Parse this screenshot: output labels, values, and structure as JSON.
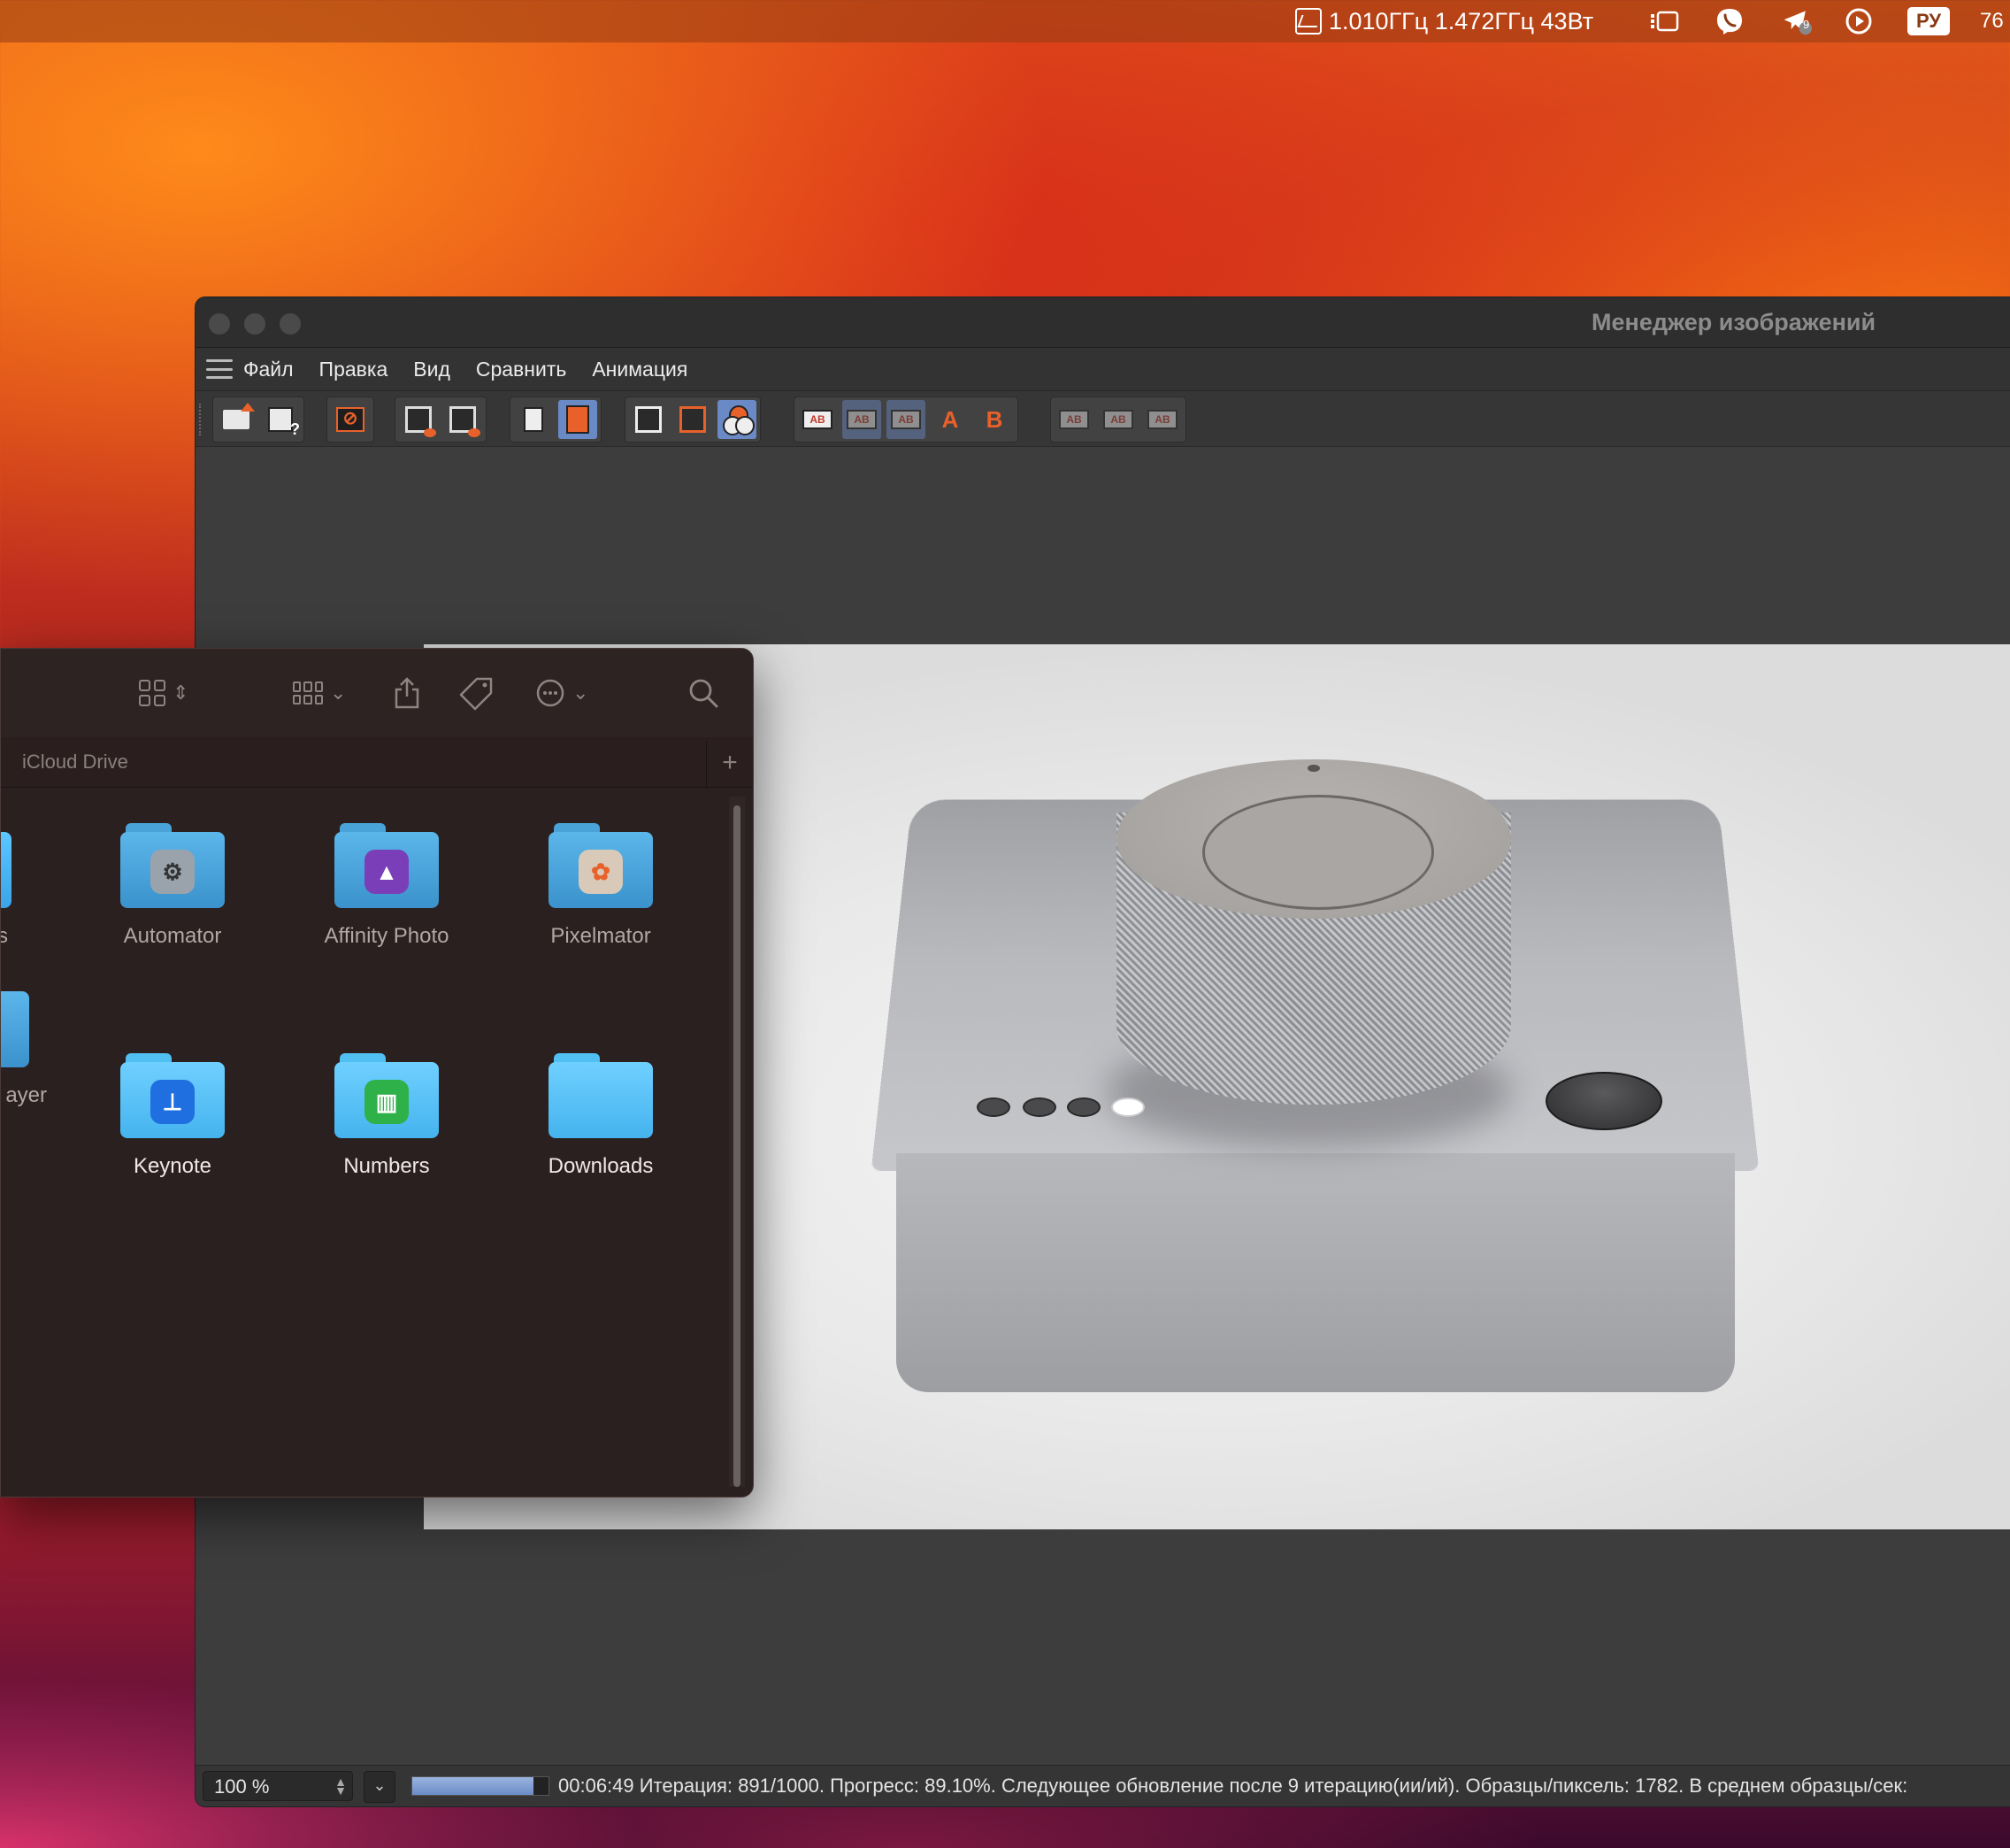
{
  "menubar": {
    "stats_text": "1.010ГГц 1.472ГГц 43Вт",
    "icons": [
      "stage-manager-icon",
      "viber-icon",
      "telegram-icon",
      "play-icon"
    ],
    "telegram_badge": "9",
    "input_language": "РУ",
    "battery_text": "76"
  },
  "image_manager": {
    "title": "Менеджер изображений",
    "menus": [
      "Файл",
      "Правка",
      "Вид",
      "Сравнить",
      "Анимация"
    ],
    "toolbar_ab_label": "AB",
    "toolbar_a_label": "A",
    "toolbar_b_label": "B",
    "status": {
      "zoom": "100 %",
      "progress_percent": 89.1,
      "text": "00:06:49 Итерация: 891/1000. Прогресс: 89.10%. Следующее обновление после 9 итерацию(ии/ий). Образцы/пиксель: 1782. В среднем образцы/сек:"
    }
  },
  "finder": {
    "tab_label": "iCloud Drive",
    "plus_label": "+",
    "partial_labels": [
      "s",
      "ayer"
    ],
    "items": [
      {
        "label": "Automator",
        "icon": "automator-icon"
      },
      {
        "label": "Affinity Photo",
        "icon": "affinity-photo-icon"
      },
      {
        "label": "Pixelmator",
        "icon": "pixelmator-icon"
      },
      {
        "label": "Keynote",
        "icon": "keynote-icon"
      },
      {
        "label": "Numbers",
        "icon": "numbers-icon"
      },
      {
        "label": "Downloads",
        "icon": "folder-icon"
      }
    ]
  },
  "colors": {
    "accent_orange": "#e8612a",
    "selection_blue": "#6a8ac6",
    "folder_blue": "#4aa3d8"
  }
}
